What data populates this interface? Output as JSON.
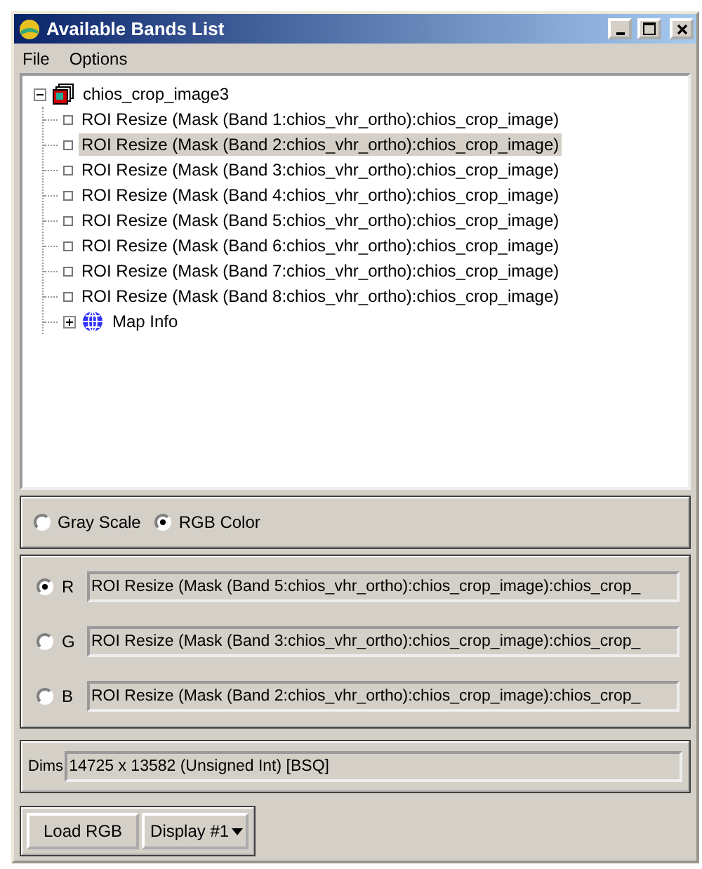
{
  "window": {
    "title": "Available Bands List"
  },
  "menu": [
    {
      "label": "File"
    },
    {
      "label": "Options"
    }
  ],
  "tree": [
    {
      "label": "chios_crop_image3",
      "kind": "image",
      "expanded": true,
      "selected": false,
      "children": [
        {
          "label": "ROI Resize (Mask (Band 1:chios_vhr_ortho):chios_crop_image)",
          "kind": "band",
          "selected": false
        },
        {
          "label": "ROI Resize (Mask (Band 2:chios_vhr_ortho):chios_crop_image)",
          "kind": "band",
          "selected": true
        },
        {
          "label": "ROI Resize (Mask (Band 3:chios_vhr_ortho):chios_crop_image)",
          "kind": "band",
          "selected": false
        },
        {
          "label": "ROI Resize (Mask (Band 4:chios_vhr_ortho):chios_crop_image)",
          "kind": "band",
          "selected": false
        },
        {
          "label": "ROI Resize (Mask (Band 5:chios_vhr_ortho):chios_crop_image)",
          "kind": "band",
          "selected": false
        },
        {
          "label": "ROI Resize (Mask (Band 6:chios_vhr_ortho):chios_crop_image)",
          "kind": "band",
          "selected": false
        },
        {
          "label": "ROI Resize (Mask (Band 7:chios_vhr_ortho):chios_crop_image)",
          "kind": "band",
          "selected": false
        },
        {
          "label": "ROI Resize (Mask (Band 8:chios_vhr_ortho):chios_crop_image)",
          "kind": "band",
          "selected": false
        },
        {
          "label": "Map Info",
          "kind": "map",
          "expanded": false,
          "selected": false
        }
      ]
    }
  ],
  "modes": [
    {
      "label": "Gray Scale",
      "selected": false
    },
    {
      "label": "RGB Color",
      "selected": true
    }
  ],
  "channels": [
    {
      "label": "R",
      "selected": true,
      "value": "ROI Resize (Mask (Band 5:chios_vhr_ortho):chios_crop_image):chios_crop_"
    },
    {
      "label": "G",
      "selected": false,
      "value": "ROI Resize (Mask (Band 3:chios_vhr_ortho):chios_crop_image):chios_crop_"
    },
    {
      "label": "B",
      "selected": false,
      "value": "ROI Resize (Mask (Band 2:chios_vhr_ortho):chios_crop_image):chios_crop_"
    }
  ],
  "dims": {
    "label": "Dims",
    "value": "14725 x 13582 (Unsigned Int) [BSQ]"
  },
  "buttons": {
    "load": "Load RGB",
    "display": "Display #1"
  }
}
